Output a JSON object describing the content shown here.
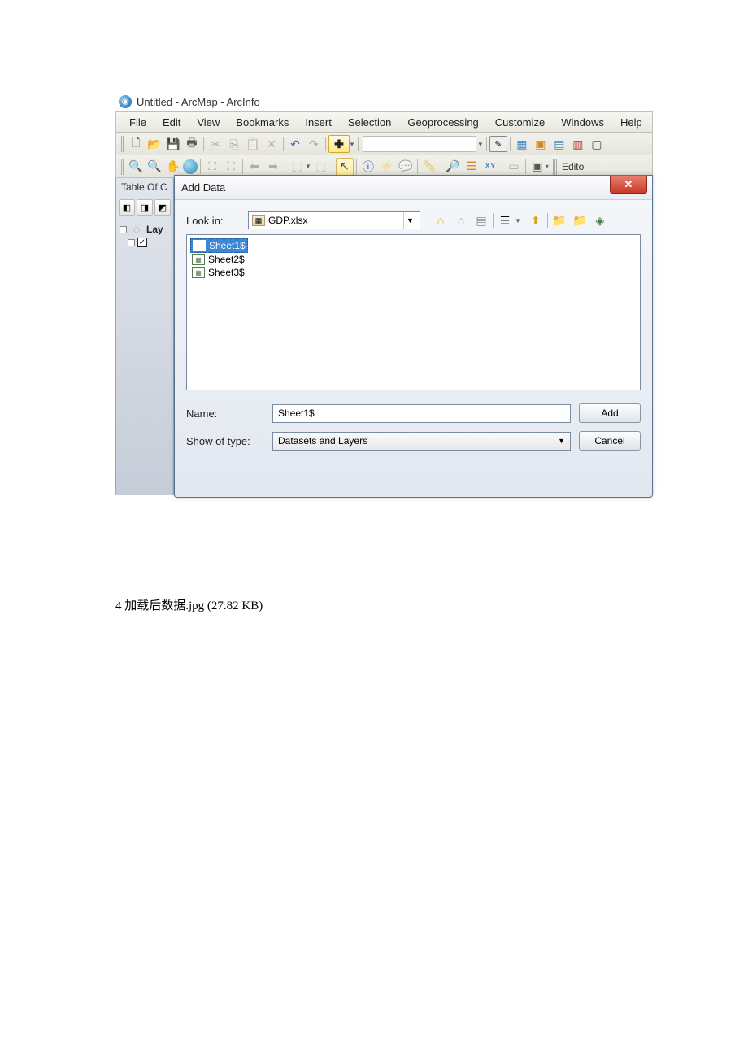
{
  "title": "Untitled - ArcMap - ArcInfo",
  "menu": [
    "File",
    "Edit",
    "View",
    "Bookmarks",
    "Insert",
    "Selection",
    "Geoprocessing",
    "Customize",
    "Windows",
    "Help"
  ],
  "toolbar2_tail": "Edito",
  "toc_title": "Table Of C",
  "toc_lay": "Lay",
  "dialog": {
    "title": "Add Data",
    "look_in_label": "Look in:",
    "look_in_value": "GDP.xlsx",
    "files": [
      {
        "name": "Sheet1$",
        "selected": true
      },
      {
        "name": "Sheet2$",
        "selected": false
      },
      {
        "name": "Sheet3$",
        "selected": false
      }
    ],
    "name_label": "Name:",
    "name_value": "Sheet1$",
    "type_label": "Show of type:",
    "type_value": "Datasets and Layers",
    "add_btn": "Add",
    "cancel_btn": "Cancel"
  },
  "caption": "4 加载后数据.jpg (27.82 KB)"
}
